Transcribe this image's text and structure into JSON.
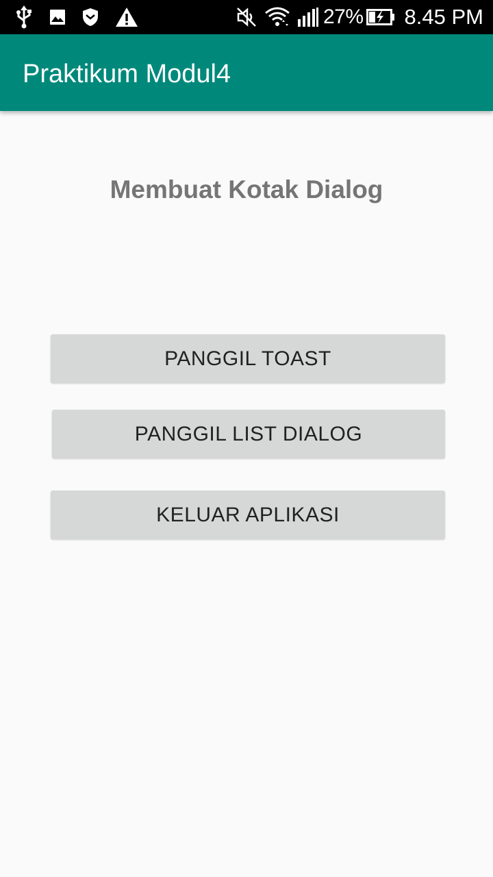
{
  "status_bar": {
    "left_icons": [
      "usb-icon",
      "image-icon",
      "shield-icon",
      "warning-icon"
    ],
    "right_icons": [
      "mute-icon",
      "wifi-icon",
      "signal-icon",
      "battery-icon"
    ],
    "battery_percent": "27%",
    "time": "8.45 PM"
  },
  "app_bar": {
    "title": "Praktikum Modul4",
    "color": "#00897b"
  },
  "main": {
    "heading": "Membuat Kotak Dialog",
    "buttons": [
      {
        "label": "PANGGIL TOAST"
      },
      {
        "label": "PANGGIL LIST DIALOG"
      },
      {
        "label": "KELUAR APLIKASI"
      }
    ]
  }
}
